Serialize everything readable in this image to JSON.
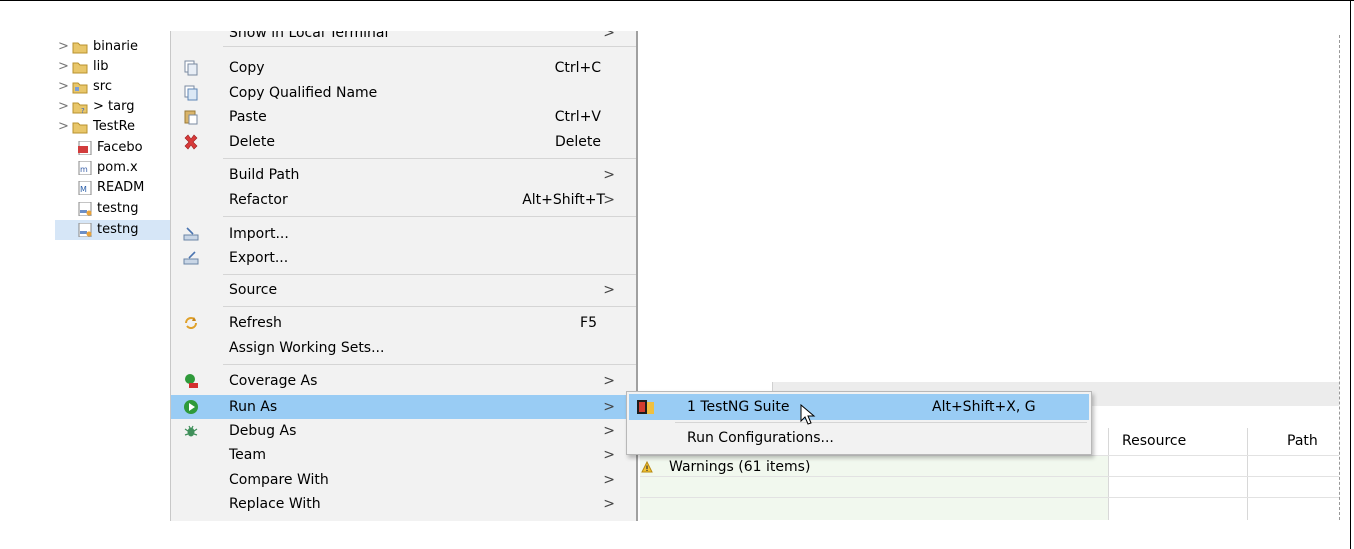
{
  "tree": {
    "items": [
      {
        "label": "binarie",
        "expandable": true,
        "icon": "folder-icon"
      },
      {
        "label": "lib",
        "expandable": true,
        "icon": "folder-icon"
      },
      {
        "label": "src",
        "expandable": true,
        "icon": "source-folder-icon"
      },
      {
        "label": "> targ",
        "expandable": true,
        "icon": "folder-unknown-icon"
      },
      {
        "label": "TestRe",
        "expandable": true,
        "icon": "folder-icon"
      },
      {
        "label": "Facebo",
        "expandable": false,
        "icon": "pdf-file-icon"
      },
      {
        "label": "pom.x",
        "expandable": false,
        "icon": "maven-file-icon"
      },
      {
        "label": "READM",
        "expandable": false,
        "icon": "markdown-file-icon"
      },
      {
        "label": "testng",
        "expandable": false,
        "icon": "xml-file-icon"
      },
      {
        "label": "testng",
        "expandable": false,
        "icon": "xml-file-icon",
        "selected": true
      }
    ]
  },
  "context_menu": {
    "items": [
      {
        "label": "Show in Local Terminal",
        "submenu": true
      },
      {
        "label": "Copy",
        "shortcut": "Ctrl+C",
        "icon": "copy-icon"
      },
      {
        "label": "Copy Qualified Name",
        "icon": "copy-qualified-icon"
      },
      {
        "label": "Paste",
        "shortcut": "Ctrl+V",
        "icon": "paste-icon"
      },
      {
        "label": "Delete",
        "shortcut": "Delete",
        "icon": "delete-icon"
      },
      {
        "label": "Build Path",
        "submenu": true
      },
      {
        "label": "Refactor",
        "shortcut": "Alt+Shift+T",
        "submenu": true
      },
      {
        "label": "Import...",
        "icon": "import-icon"
      },
      {
        "label": "Export...",
        "icon": "export-icon"
      },
      {
        "label": "Source",
        "submenu": true
      },
      {
        "label": "Refresh",
        "shortcut": "F5",
        "icon": "refresh-icon"
      },
      {
        "label": "Assign Working Sets..."
      },
      {
        "label": "Coverage As",
        "submenu": true,
        "icon": "coverage-icon"
      },
      {
        "label": "Run As",
        "submenu": true,
        "icon": "run-icon",
        "highlighted": true
      },
      {
        "label": "Debug As",
        "submenu": true,
        "icon": "debug-icon"
      },
      {
        "label": "Team",
        "submenu": true
      },
      {
        "label": "Compare With",
        "submenu": true
      },
      {
        "label": "Replace With",
        "submenu": true
      }
    ]
  },
  "run_as_submenu": {
    "items": [
      {
        "label": "1 TestNG Suite",
        "shortcut": "Alt+Shift+X, G",
        "icon": "testng-icon",
        "highlighted": true
      },
      {
        "label": "Run Configurations..."
      }
    ]
  },
  "problems_panel": {
    "columns": [
      "Resource",
      "Path"
    ],
    "warnings_label": "Warnings (61 items)"
  },
  "colors": {
    "menu_bg": "#f2f2f2",
    "highlight": "#99ccf4",
    "selection": "#d6e6f7",
    "warning_row": "#f1f8ee"
  }
}
